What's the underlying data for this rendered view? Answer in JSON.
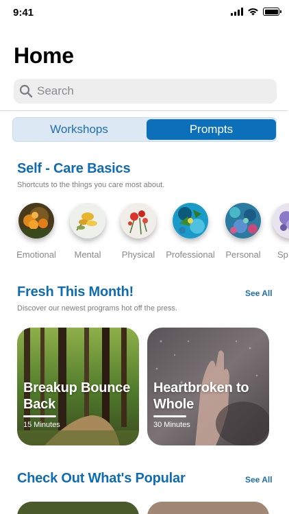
{
  "status": {
    "time": "9:41"
  },
  "header": {
    "title": "Home"
  },
  "search": {
    "placeholder": "Search"
  },
  "tabs": [
    {
      "label": "Workshops",
      "selected": false
    },
    {
      "label": "Prompts",
      "selected": true
    }
  ],
  "self_care": {
    "title": "Self - Care Basics",
    "subtitle": "Shortcuts to the things you care most about.",
    "categories": [
      {
        "label": "Emotional"
      },
      {
        "label": "Mental"
      },
      {
        "label": "Physical"
      },
      {
        "label": "Professional"
      },
      {
        "label": "Personal"
      },
      {
        "label": "Sp"
      }
    ]
  },
  "fresh": {
    "title": "Fresh This Month!",
    "subtitle": "Discover our newest programs hot off the press.",
    "see_all": "See All",
    "cards": [
      {
        "title": "Breakup Bounce Back",
        "duration": "15 Minutes"
      },
      {
        "title": "Heartbroken to Whole",
        "duration": "30 Minutes"
      }
    ]
  },
  "popular": {
    "title": "Check Out What's Popular",
    "see_all": "See All"
  },
  "colors": {
    "accent": "#0e6cb4",
    "segment_selected": "#0b6fba",
    "segment_track": "#dce8f4"
  }
}
